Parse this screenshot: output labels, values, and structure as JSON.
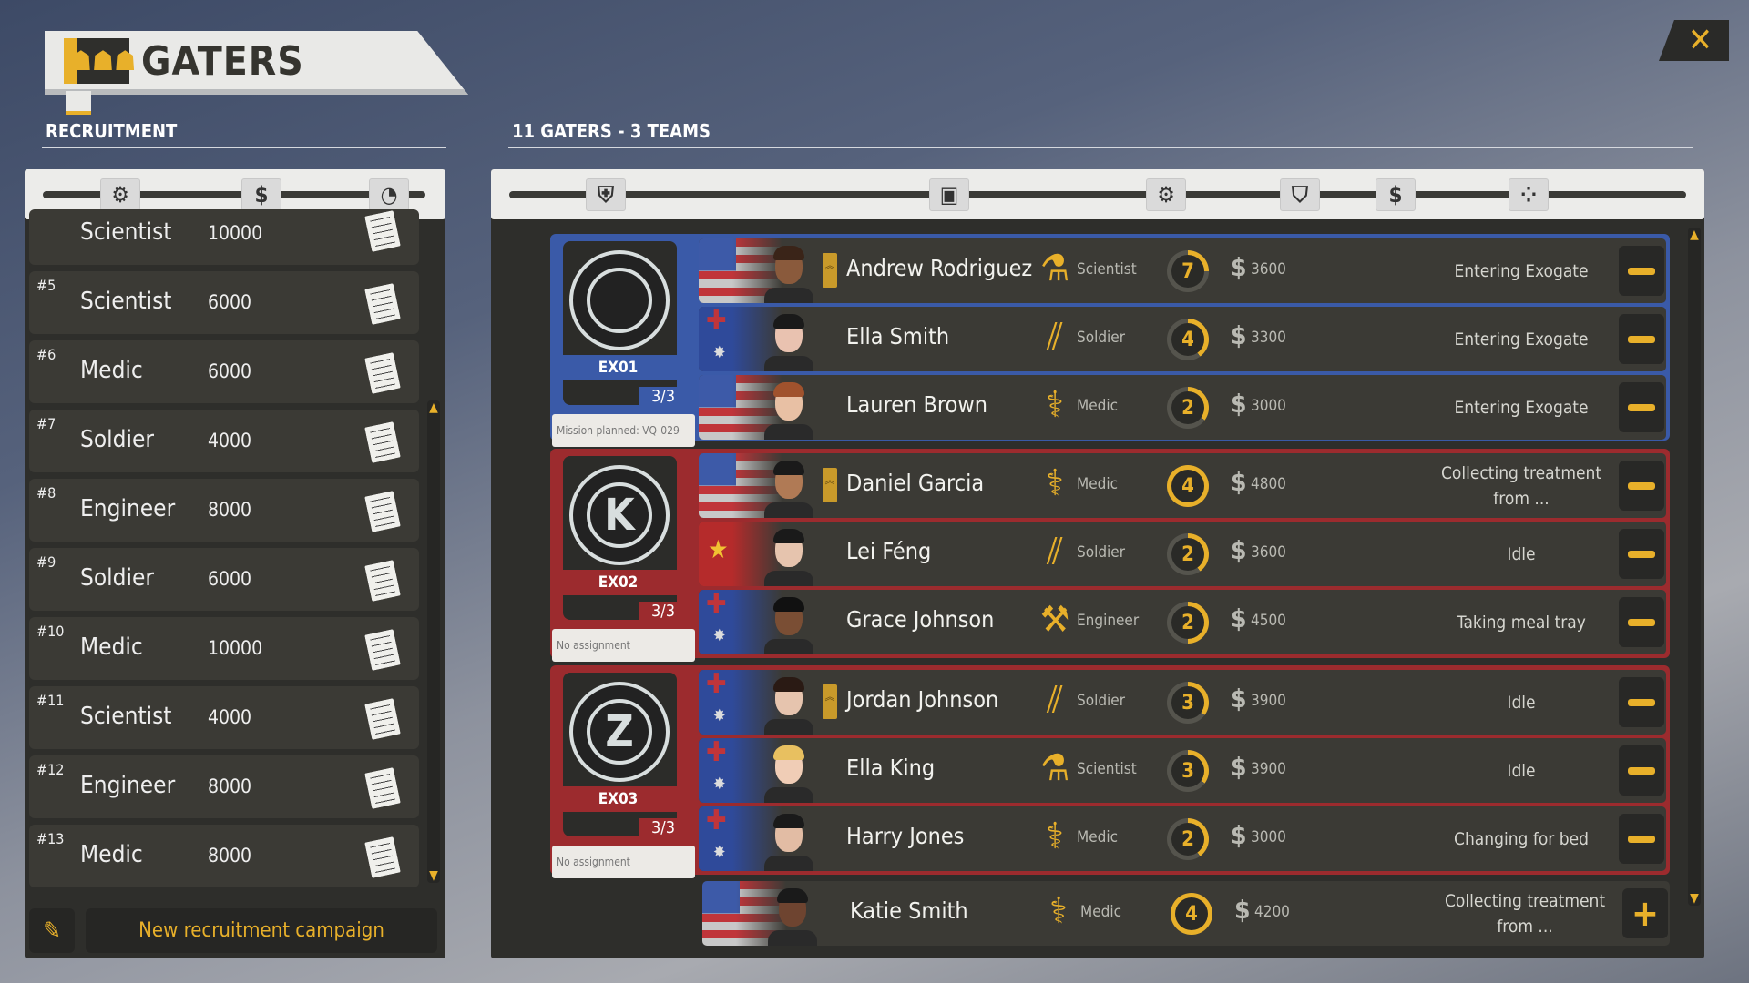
{
  "header": {
    "title": "GATERS",
    "icon": "group-icon",
    "close_icon": "close-icon"
  },
  "recruitment": {
    "section_title": "RECRUITMENT",
    "sort_icons": [
      "gear-icon",
      "dollar-icon",
      "timer-icon"
    ],
    "items": [
      {
        "num": "",
        "role": "Scientist",
        "cost": "10000"
      },
      {
        "num": "#5",
        "role": "Scientist",
        "cost": "6000"
      },
      {
        "num": "#6",
        "role": "Medic",
        "cost": "6000"
      },
      {
        "num": "#7",
        "role": "Soldier",
        "cost": "4000"
      },
      {
        "num": "#8",
        "role": "Engineer",
        "cost": "8000"
      },
      {
        "num": "#9",
        "role": "Soldier",
        "cost": "6000"
      },
      {
        "num": "#10",
        "role": "Medic",
        "cost": "10000"
      },
      {
        "num": "#11",
        "role": "Scientist",
        "cost": "4000"
      },
      {
        "num": "#12",
        "role": "Engineer",
        "cost": "8000"
      },
      {
        "num": "#13",
        "role": "Medic",
        "cost": "8000"
      }
    ],
    "campaign_button": "New recruitment campaign"
  },
  "roster": {
    "section_title": "11 GATERS - 3 TEAMS",
    "sort_icons": [
      "team-icon",
      "portrait-icon",
      "gear-icon",
      "shield-icon",
      "salary-icon",
      "status-icon"
    ],
    "teams": [
      {
        "tag": "EX01",
        "count": "3/3",
        "assignment": "Mission planned: VQ-029",
        "color": "#3a5aa8",
        "emblem": "O",
        "members": [
          {
            "name": "Andrew Rodriguez",
            "flag": "us",
            "leader": true,
            "class": "Scientist",
            "level": "7",
            "level_progress": 0.25,
            "salary": "3600",
            "status": "Entering Exogate",
            "skin": "#8a5a3c",
            "hair": "#3a2418"
          },
          {
            "name": "Ella Smith",
            "flag": "au",
            "leader": false,
            "class": "Soldier",
            "level": "4",
            "level_progress": 0.4,
            "salary": "3300",
            "status": "Entering Exogate",
            "skin": "#e9c2b0",
            "hair": "#1a1a1a"
          },
          {
            "name": "Lauren Brown",
            "flag": "us",
            "leader": false,
            "class": "Medic",
            "level": "2",
            "level_progress": 0.35,
            "salary": "3000",
            "status": "Entering Exogate",
            "skin": "#e8c0a4",
            "hair": "#a0522d"
          }
        ]
      },
      {
        "tag": "EX02",
        "count": "3/3",
        "assignment": "No assignment",
        "color": "#9c2b2e",
        "emblem": "K",
        "members": [
          {
            "name": "Daniel Garcia",
            "flag": "us",
            "leader": true,
            "class": "Medic",
            "level": "4",
            "level_progress": 1.0,
            "salary": "4800",
            "status": "Collecting treatment from ...",
            "skin": "#b07a55",
            "hair": "#1a1a1a"
          },
          {
            "name": "Lei Féng",
            "flag": "cn",
            "leader": false,
            "class": "Soldier",
            "level": "2",
            "level_progress": 0.4,
            "salary": "3600",
            "status": "Idle",
            "skin": "#e6c4ae",
            "hair": "#1a1a1a"
          },
          {
            "name": "Grace Johnson",
            "flag": "au",
            "leader": false,
            "class": "Engineer",
            "level": "2",
            "level_progress": 0.5,
            "salary": "4500",
            "status": "Taking meal tray",
            "skin": "#7a4e34",
            "hair": "#111"
          }
        ]
      },
      {
        "tag": "EX03",
        "count": "3/3",
        "assignment": "No assignment",
        "color": "#9c2b2e",
        "emblem": "Z",
        "members": [
          {
            "name": "Jordan Johnson",
            "flag": "au",
            "leader": true,
            "class": "Soldier",
            "level": "3",
            "level_progress": 0.35,
            "salary": "3900",
            "status": "Idle",
            "skin": "#e6c4ae",
            "hair": "#2a1a14"
          },
          {
            "name": "Ella King",
            "flag": "au",
            "leader": false,
            "class": "Scientist",
            "level": "3",
            "level_progress": 0.35,
            "salary": "3900",
            "status": "Idle",
            "skin": "#f0cdb6",
            "hair": "#e8c060"
          },
          {
            "name": "Harry Jones",
            "flag": "au",
            "leader": false,
            "class": "Medic",
            "level": "2",
            "level_progress": 0.4,
            "salary": "3000",
            "status": "Changing for bed",
            "skin": "#e2bca4",
            "hair": "#1a1a1a"
          }
        ]
      }
    ],
    "unassigned": [
      {
        "name": "Katie Smith",
        "flag": "us",
        "leader": false,
        "class": "Medic",
        "level": "4",
        "level_progress": 1.0,
        "salary": "4200",
        "status": "Collecting treatment from ...",
        "skin": "#6e4430",
        "hair": "#1a1a1a"
      }
    ]
  },
  "colors": {
    "accent": "#e8b02a",
    "team_blue": "#3a5aa8",
    "team_red": "#9c2b2e",
    "row_bg": "#3b3a35"
  }
}
